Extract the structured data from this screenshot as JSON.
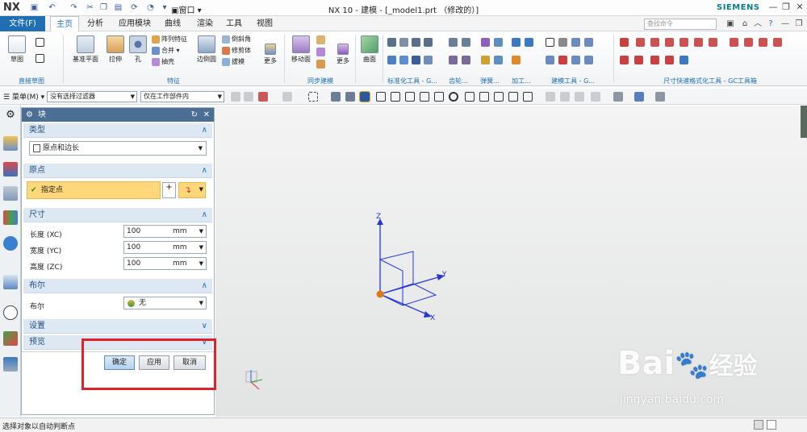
{
  "app": {
    "logo": "NX",
    "title": "NX 10 - 建模 - [_model1.prt （修改的）]",
    "brand": "SIEMENS",
    "window_menu": "窗口"
  },
  "menubar": {
    "file": "文件(F)",
    "tabs": [
      "主页",
      "分析",
      "应用模块",
      "曲线",
      "渲染",
      "工具",
      "视图"
    ],
    "active": "主页",
    "search_placeholder": "查找命令"
  },
  "ribbon": {
    "big": [
      "草图",
      "基准平面",
      "拉伸",
      "孔",
      "边倒圆",
      "更多",
      "移动面",
      "更多",
      "曲面"
    ],
    "small": [
      "阵列特征",
      "合并",
      "抽壳",
      "倒斜角",
      "修剪体",
      "拔模"
    ],
    "groups": [
      "直接草图",
      "特征",
      "同步建模",
      "标准化工具 - G...",
      "齿轮...",
      "弹簧...",
      "加工...",
      "建模工具 - G...",
      "尺寸快速格式化工具 - GC工具箱"
    ]
  },
  "toolbar2": {
    "menu": "菜单(M)",
    "filter": "没有选择过滤器",
    "scope": "仅在工作部件内"
  },
  "dialog": {
    "title": "块",
    "sections": {
      "type": "类型",
      "origin": "原点",
      "dims": "尺寸",
      "bool": "布尔",
      "settings": "设置",
      "preview": "预览"
    },
    "type_value": "原点和边长",
    "specify_point": "指定点",
    "dims": [
      {
        "label": "长度 (XC)",
        "value": "100",
        "unit": "mm"
      },
      {
        "label": "宽度 (YC)",
        "value": "100",
        "unit": "mm"
      },
      {
        "label": "高度 (ZC)",
        "value": "100",
        "unit": "mm"
      }
    ],
    "bool_label": "布尔",
    "bool_value": "无",
    "buttons": {
      "ok": "确定",
      "apply": "应用",
      "cancel": "取消"
    }
  },
  "viewport": {
    "axis_x": "X",
    "axis_y": "Y",
    "axis_z": "Z"
  },
  "status": {
    "text": "选择对象以自动判断点"
  },
  "watermark": {
    "brand": "Bai",
    "brand2": "经验",
    "url": "jingyan.baidu.com"
  },
  "colors": {
    "accent": "#1f6fb2",
    "dialog_header": "#4b6f94",
    "section_bg": "#dde8f3",
    "highlight": "#fdd77a",
    "axis": "#2436d8",
    "origin": "#e07a10",
    "red_box": "#e0202a"
  }
}
